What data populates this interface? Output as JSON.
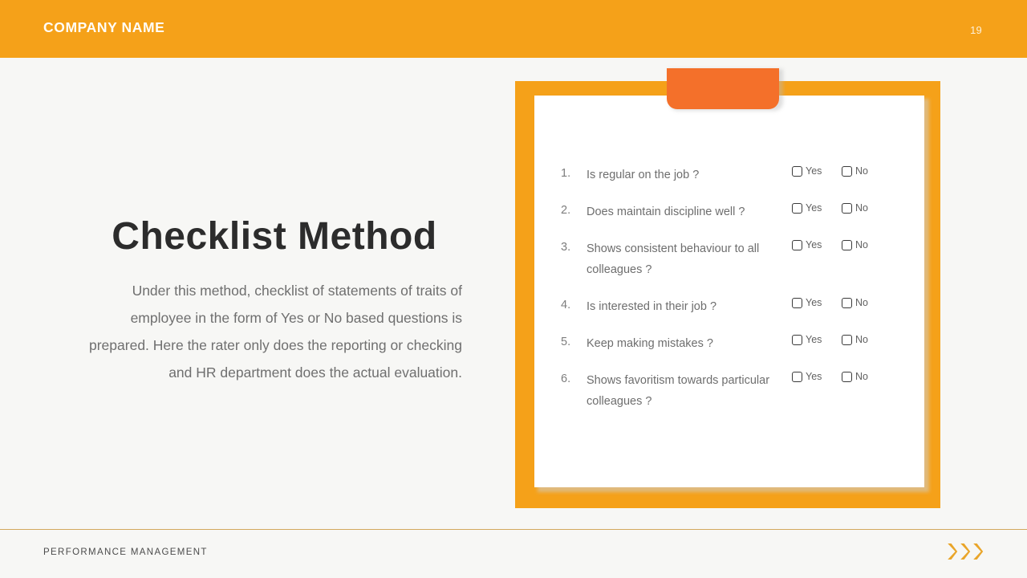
{
  "slide": {
    "page_number": "19",
    "background_color": "#f7f7f5",
    "accent_color": "#f5a119",
    "clip_color": "#f4702a"
  },
  "topbar": {
    "company_name": "COMPANY NAME"
  },
  "content": {
    "title": "Checklist Method",
    "body": "Under this method, checklist of statements of traits of employee in the form of Yes or No based questions is prepared. Here the rater only does the reporting or checking and HR department does the actual evaluation."
  },
  "checklist": {
    "option_yes": "Yes",
    "option_no": "No",
    "items": [
      {
        "number": "1.",
        "question": "Is regular on the job ?"
      },
      {
        "number": "2.",
        "question": "Does maintain discipline well ?"
      },
      {
        "number": "3.",
        "question": "Shows consistent behaviour to all colleagues ?"
      },
      {
        "number": "4.",
        "question": "Is interested in their job ?"
      },
      {
        "number": "5.",
        "question": "Keep making mistakes ?"
      },
      {
        "number": "6.",
        "question": "Shows favoritism towards particular colleagues ?"
      }
    ]
  },
  "footer": {
    "label": "PERFORMANCE  MANAGEMENT",
    "arrow_count": 3,
    "arrow_color": "#e9a529"
  }
}
